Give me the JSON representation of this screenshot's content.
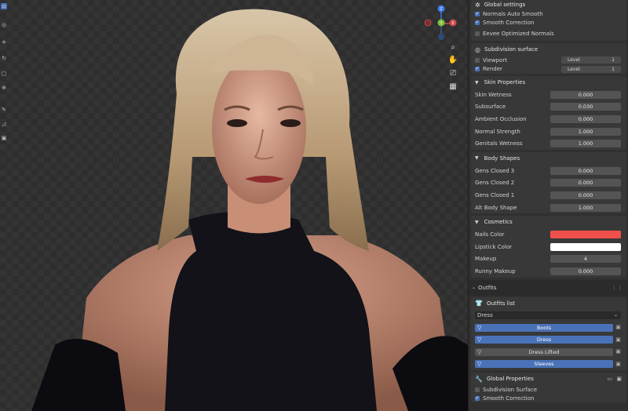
{
  "viewport": {
    "gizmo": {
      "x": "X",
      "y": "Y",
      "z": "Z"
    },
    "nav_icons": [
      "zoom-icon",
      "hand-pan-icon",
      "camera-icon",
      "grid-icon"
    ]
  },
  "global_settings": {
    "title": "Global settings",
    "normals_auto_smooth": "Normals Auto Smooth",
    "smooth_correction": "Smooth Correction",
    "eevee_optimized_normals": "Eevee Optimized Normals"
  },
  "subdivision": {
    "title": "Subdivision surface",
    "viewport": "Viewport",
    "render": "Render",
    "level_label": "Level",
    "viewport_level": "1",
    "render_level": "1"
  },
  "skin": {
    "title": "Skin Properties",
    "rows": [
      {
        "label": "Skin Wetness",
        "value": "0.000"
      },
      {
        "label": "Subsurface",
        "value": "0.030"
      },
      {
        "label": "Ambient Occlusion",
        "value": "0.000"
      },
      {
        "label": "Normal Strength",
        "value": "1.000"
      },
      {
        "label": "Genitals Wetness",
        "value": "1.000"
      }
    ]
  },
  "body_shapes": {
    "title": "Body Shapes",
    "rows": [
      {
        "label": "Gens Closed 3",
        "value": "0.000"
      },
      {
        "label": "Gens Closed 2",
        "value": "0.000"
      },
      {
        "label": "Gens Closed 1",
        "value": "0.000"
      },
      {
        "label": "Alt Body Shape",
        "value": "1.000"
      }
    ]
  },
  "cosmetics": {
    "title": "Cosmetics",
    "nails_label": "Nails Color",
    "nails_color": "#f0504c",
    "lipstick_label": "Lipstick Color",
    "lipstick_color": "#ffffff",
    "makeup_label": "Makeup",
    "makeup_value": "4",
    "runny_label": "Runny Makeup",
    "runny_value": "0.000"
  },
  "outfits": {
    "title": "Outfits",
    "list_label": "Outfits list",
    "selected": "Dress",
    "items": [
      {
        "label": "Boots",
        "active": true
      },
      {
        "label": "Dress",
        "active": true
      },
      {
        "label": "Dress Lifted",
        "active": false
      },
      {
        "label": "Sleeves",
        "active": true
      }
    ]
  },
  "global_properties": {
    "title": "Global Properties",
    "subdivision_surface": "Subdivision Surface",
    "smooth_correction": "Smooth Correction"
  },
  "colors": {
    "accent": "#4a72b8",
    "panel": "#303030",
    "section": "#383838",
    "field": "#545454"
  }
}
